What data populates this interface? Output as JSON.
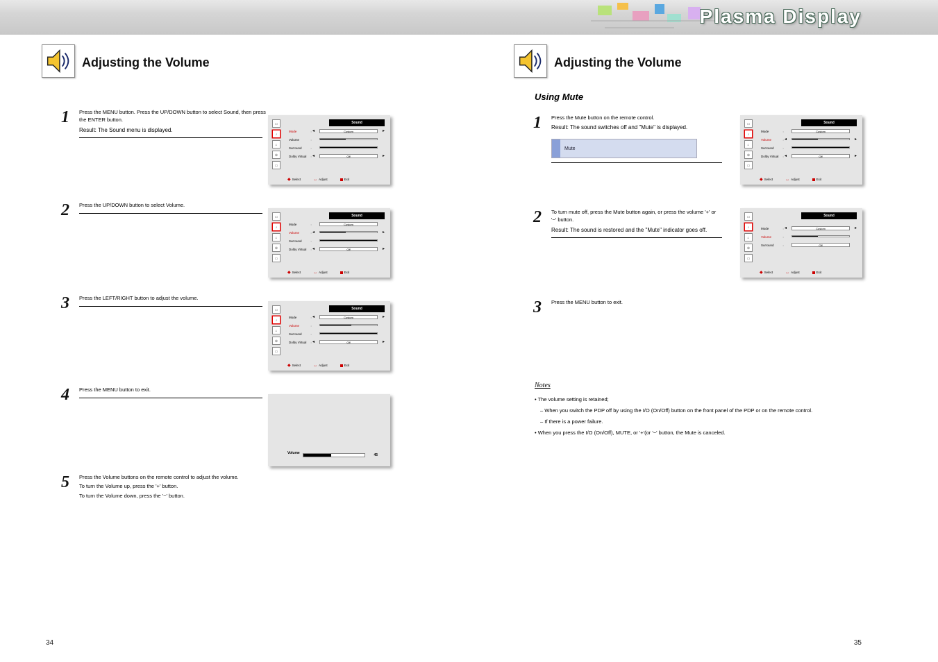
{
  "header": {
    "title": "Plasma Display"
  },
  "left_page": {
    "icon_alt": "speaker-icon",
    "title": "Adjusting the Volume",
    "steps": {
      "s1": {
        "num": "1",
        "text": "Press the MENU button.\nPress the UP/DOWN button to select Sound, then press the ENTER button.",
        "result": "Result: The Sound menu is displayed."
      },
      "s2": {
        "num": "2",
        "text": "Press the UP/DOWN button to select Volume."
      },
      "s3": {
        "num": "3",
        "text": "Press the LEFT/RIGHT button to adjust the volume."
      },
      "s4": {
        "num": "4",
        "text": "Press the MENU button to exit."
      },
      "s5": {
        "num": "5",
        "line1": "Press the Volume buttons on the remote control to adjust the volume.",
        "line2": "To turn the Volume up, press the '+' button.",
        "line3": "To turn the Volume down, press the '−' button."
      }
    },
    "page_num": "34"
  },
  "right_page": {
    "icon_alt": "speaker-icon",
    "title": "Adjusting the Volume",
    "mute_title": "Using Mute",
    "steps": {
      "s1": {
        "num": "1",
        "text": "Press the Mute button on the remote control.",
        "result": "Result: The sound switches off and \"Mute\" is displayed.",
        "callout": "Mute"
      },
      "s2": {
        "num": "2",
        "text": "To turn mute off, press the Mute button again, or press the volume '+' or '−' button.",
        "result": "Result: The sound is restored and the \"Mute\" indicator goes off."
      },
      "s3": {
        "num": "3",
        "text": "Press the MENU button to exit."
      }
    },
    "notes_label": "Notes",
    "notes": {
      "n1": "• The volume setting is retained;",
      "n1a": "  – When you switch the PDP off by using the I/O (On/Off) button on the front panel of the PDP or on the remote control.",
      "n1b": "  – If there is a power failure.",
      "n2": "• When you press the I/O (On/Off), MUTE, or '+'(or '−' button, the Mute is canceled."
    },
    "page_num": "35"
  },
  "osd": {
    "title": "Sound",
    "menu_items": {
      "mode": "Mode",
      "volume": "Volume",
      "surround": "Surround",
      "dolby": "Dolby Virtual",
      "custom": "Custom"
    },
    "values": {
      "mode": "Custom",
      "volume_pct": 45,
      "surround": "Off",
      "dolby": "Off"
    },
    "footer": {
      "select": "Select",
      "adjust": "Adjust",
      "exit": "Exit"
    },
    "vol_label": "Volume",
    "vol_num": "45"
  }
}
